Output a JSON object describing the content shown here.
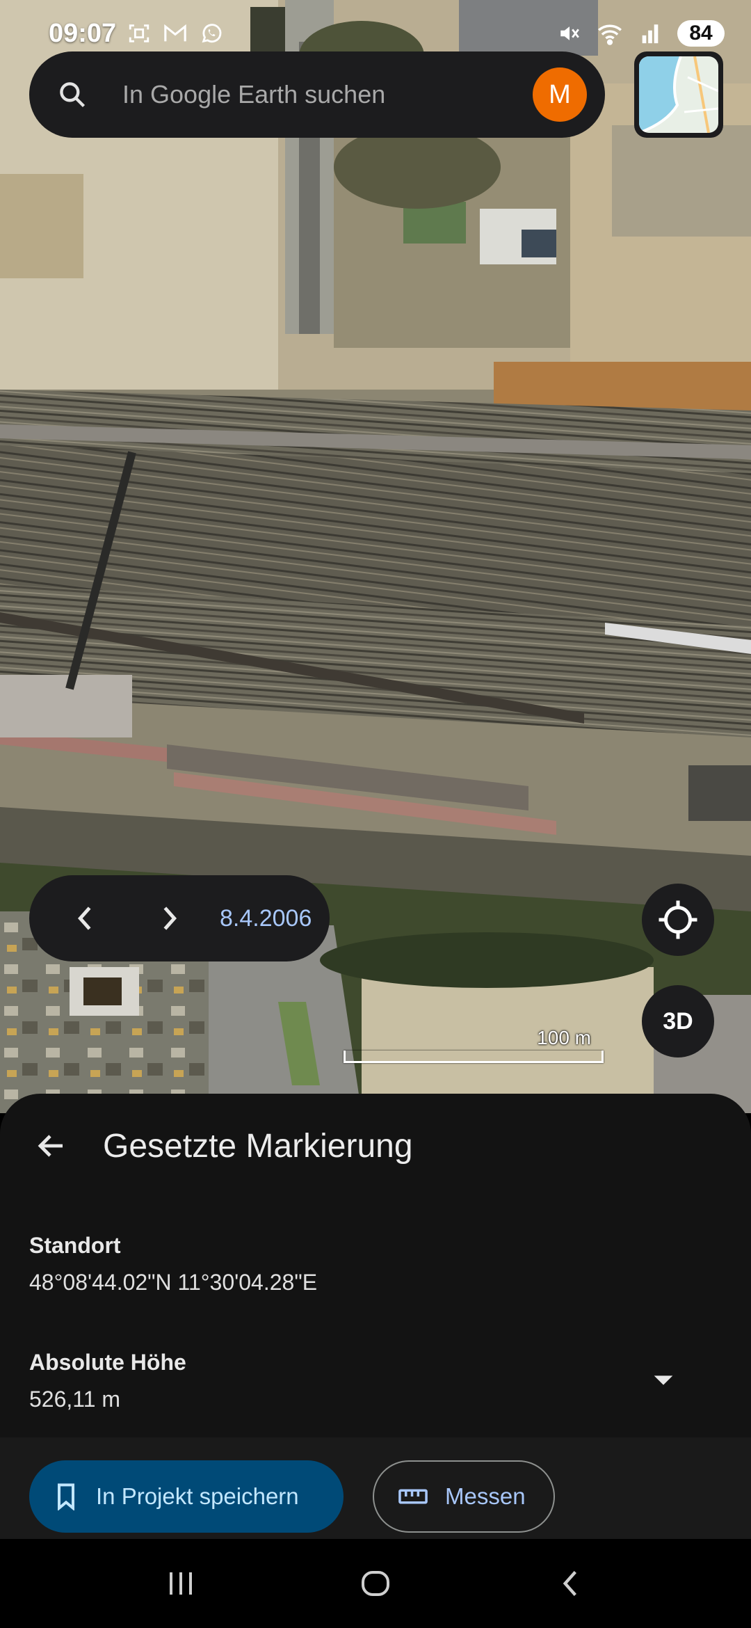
{
  "status_bar": {
    "time": "09:07",
    "battery": "84",
    "left_icons": [
      "screenshot-icon",
      "gmail-icon",
      "whatsapp-icon"
    ],
    "right_icons": [
      "mute-icon",
      "wifi-icon",
      "signal-icon"
    ]
  },
  "search": {
    "placeholder": "In Google Earth suchen",
    "avatar_letter": "M",
    "avatar_color": "#ef6c00"
  },
  "timeline": {
    "date": "8.4.2006"
  },
  "map_controls": {
    "three_d_label": "3D",
    "scale_label": "100 m"
  },
  "sheet": {
    "title": "Gesetzte Markierung",
    "location_label": "Standort",
    "location_value": "48°08'44.02\"N 11°30'04.28\"E",
    "altitude_label": "Absolute Höhe",
    "altitude_value": "526,11 m"
  },
  "actions": {
    "save_label": "In Projekt speichern",
    "measure_label": "Messen"
  },
  "colors": {
    "accent_blue": "#a8c7fa",
    "save_button_bg": "#004a77",
    "panel_bg": "#1c1c1e"
  }
}
